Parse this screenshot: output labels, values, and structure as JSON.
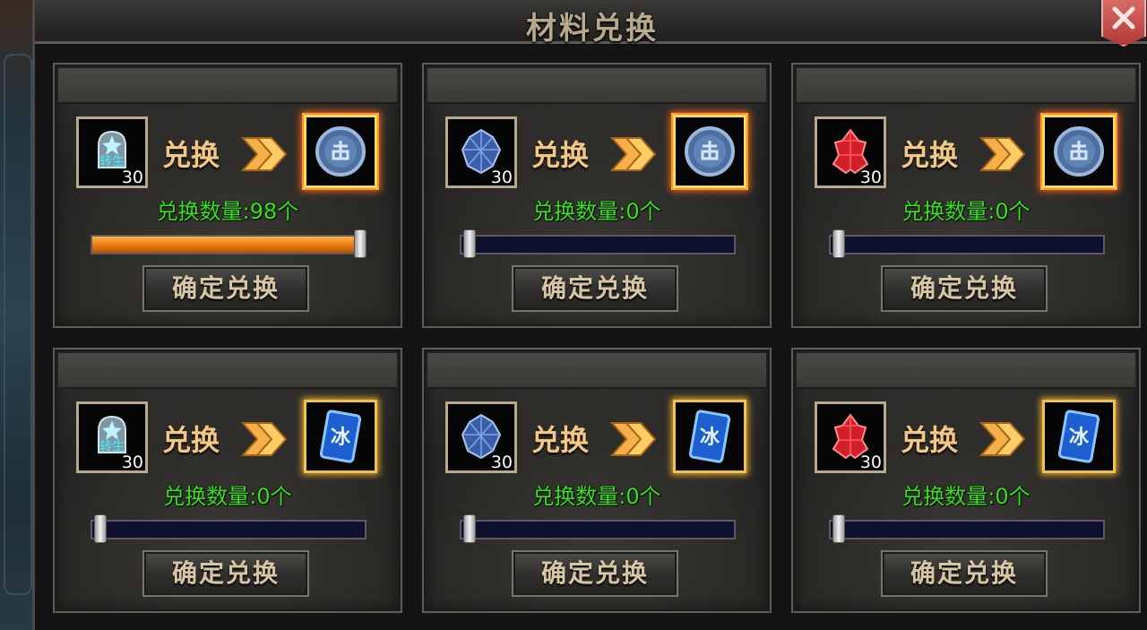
{
  "window": {
    "title": "材料兑换"
  },
  "cards": [
    {
      "source": {
        "icon": "rebirth-stone-icon",
        "count": "30"
      },
      "exchange_label": "兑换",
      "target": {
        "icon": "blue-seal-coin-icon"
      },
      "quantity_text": "兑换数量:98个",
      "slider": {
        "fraction": 0.98
      },
      "confirm_label": "确定兑换"
    },
    {
      "source": {
        "icon": "blue-crystal-icon",
        "count": "30"
      },
      "exchange_label": "兑换",
      "target": {
        "icon": "blue-seal-coin-icon"
      },
      "quantity_text": "兑换数量:0个",
      "slider": {
        "fraction": 0
      },
      "confirm_label": "确定兑换"
    },
    {
      "source": {
        "icon": "red-crystal-icon",
        "count": "30"
      },
      "exchange_label": "兑换",
      "target": {
        "icon": "blue-seal-coin-icon"
      },
      "quantity_text": "兑换数量:0个",
      "slider": {
        "fraction": 0
      },
      "confirm_label": "确定兑换"
    },
    {
      "source": {
        "icon": "rebirth-stone-icon",
        "count": "30"
      },
      "exchange_label": "兑换",
      "target": {
        "icon": "ice-rune-card-icon"
      },
      "quantity_text": "兑换数量:0个",
      "slider": {
        "fraction": 0
      },
      "confirm_label": "确定兑换"
    },
    {
      "source": {
        "icon": "blue-crystal-icon",
        "count": "30"
      },
      "exchange_label": "兑换",
      "target": {
        "icon": "ice-rune-card-icon"
      },
      "quantity_text": "兑换数量:0个",
      "slider": {
        "fraction": 0
      },
      "confirm_label": "确定兑换"
    },
    {
      "source": {
        "icon": "red-crystal-icon",
        "count": "30"
      },
      "exchange_label": "兑换",
      "target": {
        "icon": "ice-rune-card-icon"
      },
      "quantity_text": "兑换数量:0个",
      "slider": {
        "fraction": 0
      },
      "confirm_label": "确定兑换"
    }
  ],
  "icon_text": {
    "rebirth": "转生",
    "ice": "冰"
  },
  "colors": {
    "quantity": "#36e21e",
    "label": "#f2c884",
    "slider_fill": "#e87a10",
    "slider_track": "#0f0f2e"
  }
}
